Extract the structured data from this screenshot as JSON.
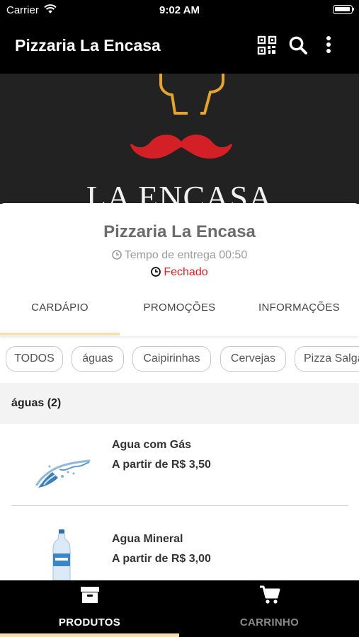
{
  "status_bar": {
    "carrier": "Carrier",
    "time": "9:02 AM"
  },
  "app_bar": {
    "title": "Pizzaria La Encasa",
    "icons": [
      "qr-code-icon",
      "search-icon",
      "more-vertical-icon"
    ]
  },
  "banner": {
    "brand_text": "LA ENCASA",
    "hat_color": "#e6a52a",
    "mustache_color": "#d32027"
  },
  "store": {
    "name": "Pizzaria La Encasa",
    "delivery_time": "Tempo de entrega 00:50",
    "status": "Fechado",
    "status_color": "#e31c1c"
  },
  "tabs": [
    {
      "label": "CARDÁPIO",
      "selected": true
    },
    {
      "label": "PROMOÇÕES",
      "selected": false
    },
    {
      "label": "INFORMAÇÕES",
      "selected": false
    }
  ],
  "categories": [
    "TODOS",
    "águas",
    "Caipirinhas",
    "Cervejas",
    "Pizza Salgada"
  ],
  "section": {
    "title": "águas (2)"
  },
  "products": [
    {
      "name": "Agua com Gás",
      "price": "A partir de R$ 3,50",
      "image": "water-splash-image"
    },
    {
      "name": "Agua Mineral",
      "price": "A partir de R$ 3,00",
      "image": "water-bottle-image"
    }
  ],
  "bottom_nav": [
    {
      "label": "PRODUTOS",
      "icon": "archive-box-icon",
      "selected": true,
      "color": "#ffffff"
    },
    {
      "label": "CARRINHO",
      "icon": "cart-icon",
      "selected": false,
      "color": "#8a8a8a"
    }
  ],
  "accent_color": "#f4dfb3"
}
